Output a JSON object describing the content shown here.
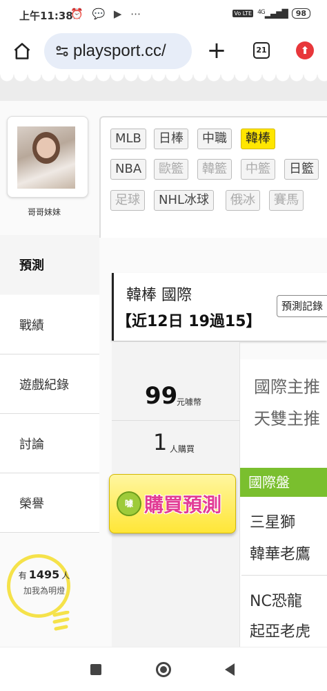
{
  "status": {
    "time": "上午11:38",
    "icons": "⏰ 💬 ▶ ⋯",
    "volte": "Vo LTE",
    "network": "4G",
    "battery": "98"
  },
  "browser": {
    "url": "playsport.cc/",
    "tab_count": "21"
  },
  "profile": {
    "name": "哥哥妹妹"
  },
  "sidebar": {
    "items": [
      {
        "label": "預測"
      },
      {
        "label": "戰績"
      },
      {
        "label": "遊戲紀錄"
      },
      {
        "label": "討論"
      },
      {
        "label": "榮譽"
      }
    ]
  },
  "lightbulb": {
    "prefix": "有",
    "count": "1495",
    "suffix": "人",
    "action": "加我為明燈"
  },
  "leagues": [
    {
      "label": "MLB",
      "state": "normal"
    },
    {
      "label": "日棒",
      "state": "normal"
    },
    {
      "label": "中職",
      "state": "normal"
    },
    {
      "label": "韓棒",
      "state": "selected"
    },
    {
      "label": "NBA",
      "state": "normal"
    },
    {
      "label": "歐籃",
      "state": "disabled"
    },
    {
      "label": "韓籃",
      "state": "disabled"
    },
    {
      "label": "中籃",
      "state": "disabled"
    },
    {
      "label": "日籃",
      "state": "normal"
    },
    {
      "label": "足球",
      "state": "disabled"
    },
    {
      "label": "NHL冰球",
      "state": "normal"
    },
    {
      "label": "俄冰",
      "state": "disabled"
    },
    {
      "label": "賽馬",
      "state": "disabled"
    }
  ],
  "prediction": {
    "title": "韓棒 國際",
    "record": "【近12日 19過15】",
    "record_button": "預測記錄"
  },
  "purchase": {
    "price": "99",
    "price_unit": "元噱幣",
    "buyers": "1",
    "buyers_unit": "人購買",
    "buy_label": "購買預測",
    "coin_label": "噱"
  },
  "game": {
    "line1": "國際主推",
    "line2": "天雙主推",
    "market": "國際盤",
    "teams": [
      "三星獅",
      "韓華老鷹",
      "NC恐龍",
      "起亞老虎"
    ]
  },
  "colors": {
    "selected_chip": "#ffe600",
    "market_header": "#7abf2e",
    "buy_text": "#e23c95",
    "upgrade": "#e8373b"
  }
}
